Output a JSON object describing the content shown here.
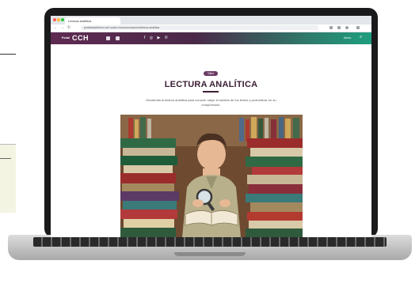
{
  "browser": {
    "tab_title": "Lectura analítica",
    "url": "portalacademico.cch.unam.mx/comunicacion/lectura-analitica"
  },
  "site_header": {
    "logo_prefix": "Portal",
    "logo": "CCH",
    "social_icons": "f ◎ ▶ ✆",
    "right_link": "Inicio",
    "search_icon": "search-icon"
  },
  "page": {
    "badge": "Taller",
    "title": "LECTURA ANALÍTICA",
    "description": "Desarrolla la lectura analítica para conocer mejor el sentido de los textos y profundizar en su comprensión."
  },
  "colors": {
    "header_start": "#5e2a52",
    "header_end": "#1e9e7e",
    "title": "#3d2036",
    "badge": "#6b3a63"
  }
}
